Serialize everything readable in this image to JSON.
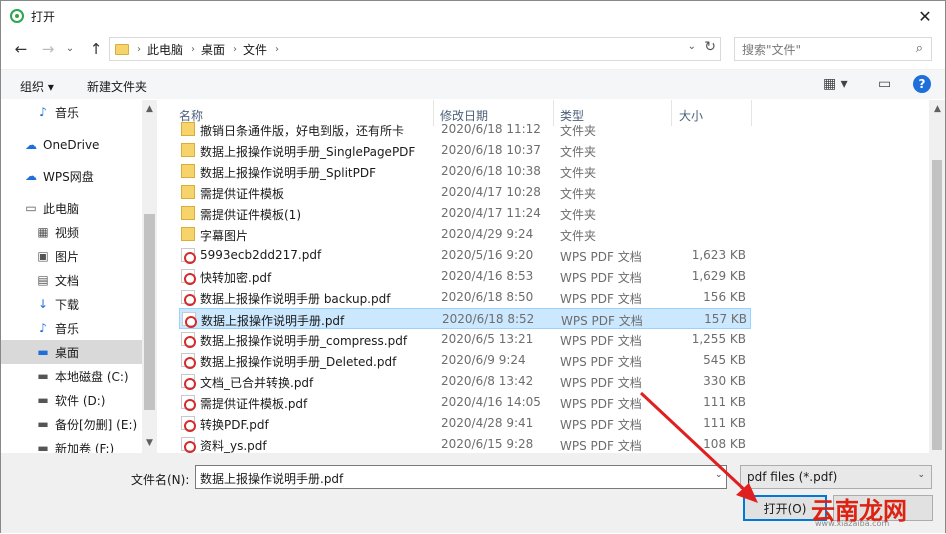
{
  "window": {
    "title": "打开",
    "close": "✕"
  },
  "nav_buttons": {
    "back": "←",
    "forward": "→",
    "dropdown": "⌄",
    "up": "↑"
  },
  "address": {
    "segments": [
      "此电脑",
      "桌面",
      "文件"
    ],
    "separator": "›",
    "refresh": "↻",
    "dropdown": "⌄"
  },
  "search": {
    "placeholder": "搜索\"文件\""
  },
  "toolbar": {
    "organize": "组织 ▾",
    "new_folder": "新建文件夹",
    "view_menu": "▦ ▾",
    "preview": "▭",
    "help": "?"
  },
  "sidebar": {
    "items": [
      {
        "label": "音乐",
        "icon": "music-icon",
        "glyph": "♪"
      },
      {
        "label": "OneDrive",
        "icon": "cloud-icon",
        "glyph": "☁"
      },
      {
        "label": "WPS网盘",
        "icon": "wps-cloud-icon",
        "glyph": "☁"
      },
      {
        "label": "此电脑",
        "icon": "computer-icon",
        "glyph": "▭"
      },
      {
        "label": "视频",
        "icon": "video-icon",
        "glyph": "▦"
      },
      {
        "label": "图片",
        "icon": "pictures-icon",
        "glyph": "▣"
      },
      {
        "label": "文档",
        "icon": "documents-icon",
        "glyph": "▤"
      },
      {
        "label": "下载",
        "icon": "download-icon",
        "glyph": "↓"
      },
      {
        "label": "音乐",
        "icon": "music-icon",
        "glyph": "♪"
      },
      {
        "label": "桌面",
        "icon": "desktop-icon",
        "glyph": "▬",
        "selected": true
      },
      {
        "label": "本地磁盘 (C:)",
        "icon": "drive-icon",
        "glyph": "▬"
      },
      {
        "label": "软件 (D:)",
        "icon": "drive-icon",
        "glyph": "▬"
      },
      {
        "label": "备份[勿删] (E:)",
        "icon": "drive-icon",
        "glyph": "▬"
      },
      {
        "label": "新加卷 (F:)",
        "icon": "drive-icon",
        "glyph": "▬"
      }
    ]
  },
  "columns": {
    "name": "名称",
    "date": "修改日期",
    "type": "类型",
    "size": "大小"
  },
  "files": [
    {
      "name": "撤销日条通件版，好电到版，还有所卡",
      "date": "2020/6/18 11:12",
      "type": "文件夹",
      "size": "",
      "kind": "folder"
    },
    {
      "name": "数据上报操作说明手册_SinglePagePDF",
      "date": "2020/6/18 10:37",
      "type": "文件夹",
      "size": "",
      "kind": "folder"
    },
    {
      "name": "数据上报操作说明手册_SplitPDF",
      "date": "2020/6/18 10:38",
      "type": "文件夹",
      "size": "",
      "kind": "folder"
    },
    {
      "name": "需提供证件模板",
      "date": "2020/4/17 10:28",
      "type": "文件夹",
      "size": "",
      "kind": "folder"
    },
    {
      "name": "需提供证件模板(1)",
      "date": "2020/4/17 11:24",
      "type": "文件夹",
      "size": "",
      "kind": "folder"
    },
    {
      "name": "字幕图片",
      "date": "2020/4/29 9:24",
      "type": "文件夹",
      "size": "",
      "kind": "folder"
    },
    {
      "name": "5993ecb2dd217.pdf",
      "date": "2020/5/16 9:20",
      "type": "WPS PDF 文档",
      "size": "1,623 KB",
      "kind": "pdf"
    },
    {
      "name": "快转加密.pdf",
      "date": "2020/4/16 8:53",
      "type": "WPS PDF 文档",
      "size": "1,629 KB",
      "kind": "pdf"
    },
    {
      "name": "数据上报操作说明手册 backup.pdf",
      "date": "2020/6/18 8:50",
      "type": "WPS PDF 文档",
      "size": "156 KB",
      "kind": "pdf"
    },
    {
      "name": "数据上报操作说明手册.pdf",
      "date": "2020/6/18 8:52",
      "type": "WPS PDF 文档",
      "size": "157 KB",
      "kind": "pdf",
      "selected": true
    },
    {
      "name": "数据上报操作说明手册_compress.pdf",
      "date": "2020/6/5 13:21",
      "type": "WPS PDF 文档",
      "size": "1,255 KB",
      "kind": "pdf"
    },
    {
      "name": "数据上报操作说明手册_Deleted.pdf",
      "date": "2020/6/9 9:24",
      "type": "WPS PDF 文档",
      "size": "545 KB",
      "kind": "pdf"
    },
    {
      "name": "文档_已合并转换.pdf",
      "date": "2020/6/8 13:42",
      "type": "WPS PDF 文档",
      "size": "330 KB",
      "kind": "pdf"
    },
    {
      "name": "需提供证件模板.pdf",
      "date": "2020/4/16 14:05",
      "type": "WPS PDF 文档",
      "size": "111 KB",
      "kind": "pdf"
    },
    {
      "name": "转换PDF.pdf",
      "date": "2020/4/28 9:41",
      "type": "WPS PDF 文档",
      "size": "111 KB",
      "kind": "pdf"
    },
    {
      "name": "资料_ys.pdf",
      "date": "2020/6/15 9:28",
      "type": "WPS PDF 文档",
      "size": "108 KB",
      "kind": "pdf"
    }
  ],
  "footer": {
    "filename_label": "文件名(N):",
    "filename_value": "数据上报操作说明手册.pdf",
    "filetype": "pdf files (*.pdf)",
    "open": "打开(O)",
    "cancel": ""
  },
  "scroll_glyphs": {
    "up": "▲",
    "down": "▼",
    "dd": "⌄"
  },
  "watermark": {
    "text": "云南龙网",
    "url": "www.xiazaiba.com"
  },
  "colors": {
    "accent": "#0078d7",
    "selection": "#cce8ff",
    "arrow": "#e02020"
  }
}
